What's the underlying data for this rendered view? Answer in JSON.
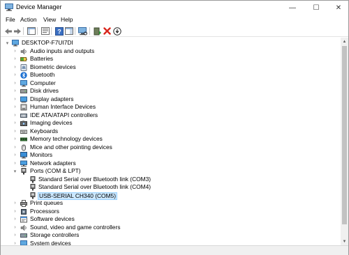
{
  "window": {
    "title": "Device Manager",
    "controls": {
      "minimize": "—",
      "maximize": "☐",
      "close": "✕"
    }
  },
  "menu": [
    "File",
    "Action",
    "View",
    "Help"
  ],
  "toolbar": {
    "buttons": [
      "back-arrow-icon",
      "forward-arrow-icon",
      "show-hide-console-tree-icon",
      "properties-icon",
      "help-icon",
      "action-pane-icon",
      "scan-hardware-icon",
      "update-driver-icon",
      "uninstall-icon",
      "disable-device-icon"
    ]
  },
  "tree": {
    "root": "DESKTOP-F7UI7DI",
    "categories": [
      {
        "label": "Audio inputs and outputs",
        "icon": "speaker-icon"
      },
      {
        "label": "Batteries",
        "icon": "battery-icon"
      },
      {
        "label": "Biometric devices",
        "icon": "fingerprint-icon"
      },
      {
        "label": "Bluetooth",
        "icon": "bluetooth-icon"
      },
      {
        "label": "Computer",
        "icon": "computer-icon"
      },
      {
        "label": "Disk drives",
        "icon": "disk-drive-icon"
      },
      {
        "label": "Display adapters",
        "icon": "display-adapter-icon"
      },
      {
        "label": "Human Interface Devices",
        "icon": "hid-icon"
      },
      {
        "label": "IDE ATA/ATAPI controllers",
        "icon": "ide-controller-icon"
      },
      {
        "label": "Imaging devices",
        "icon": "camera-icon"
      },
      {
        "label": "Keyboards",
        "icon": "keyboard-icon"
      },
      {
        "label": "Memory technology devices",
        "icon": "memory-icon"
      },
      {
        "label": "Mice and other pointing devices",
        "icon": "mouse-icon"
      },
      {
        "label": "Monitors",
        "icon": "monitor-icon"
      },
      {
        "label": "Network adapters",
        "icon": "network-adapter-icon"
      },
      {
        "label": "Ports (COM & LPT)",
        "icon": "port-icon",
        "expanded": true,
        "children": [
          {
            "label": "Standard Serial over Bluetooth link (COM3)",
            "icon": "port-icon"
          },
          {
            "label": "Standard Serial over Bluetooth link (COM4)",
            "icon": "port-icon"
          },
          {
            "label": "USB-SERIAL CH340 (COM5)",
            "icon": "port-icon",
            "selected": true
          }
        ]
      },
      {
        "label": "Print queues",
        "icon": "printer-icon"
      },
      {
        "label": "Processors",
        "icon": "processor-icon"
      },
      {
        "label": "Software devices",
        "icon": "software-device-icon"
      },
      {
        "label": "Sound, video and game controllers",
        "icon": "sound-icon"
      },
      {
        "label": "Storage controllers",
        "icon": "storage-controller-icon"
      },
      {
        "label": "System devices",
        "icon": "system-devices-icon"
      }
    ]
  }
}
